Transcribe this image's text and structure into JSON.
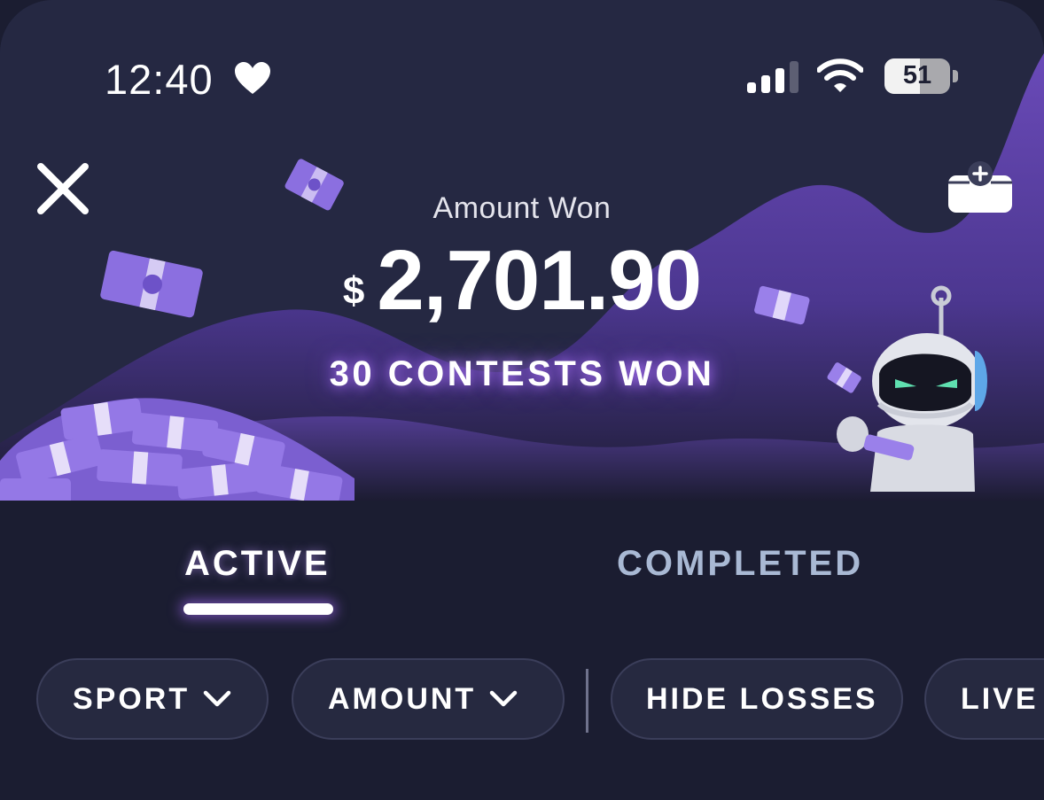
{
  "status_bar": {
    "time": "12:40",
    "battery": "51"
  },
  "header": {
    "close_icon": "close-icon",
    "wallet_icon": "wallet-add-icon",
    "amount_label": "Amount Won",
    "currency_symbol": "$",
    "amount_value": "2,701.90",
    "contests_won": "30 CONTESTS WON"
  },
  "tabs": [
    {
      "label": "ACTIVE",
      "selected": true
    },
    {
      "label": "COMPLETED",
      "selected": false
    }
  ],
  "filters": [
    {
      "label": "SPORT",
      "has_dropdown": true
    },
    {
      "label": "AMOUNT",
      "has_dropdown": true
    },
    {
      "label": "HIDE LOSSES",
      "has_dropdown": false
    },
    {
      "label": "LIVE",
      "has_dropdown": false
    }
  ],
  "colors": {
    "background": "#1b1d31",
    "hero_purple": "#5f45a8",
    "chip_bg": "#262940",
    "tab_inactive": "#a9b9d4"
  }
}
